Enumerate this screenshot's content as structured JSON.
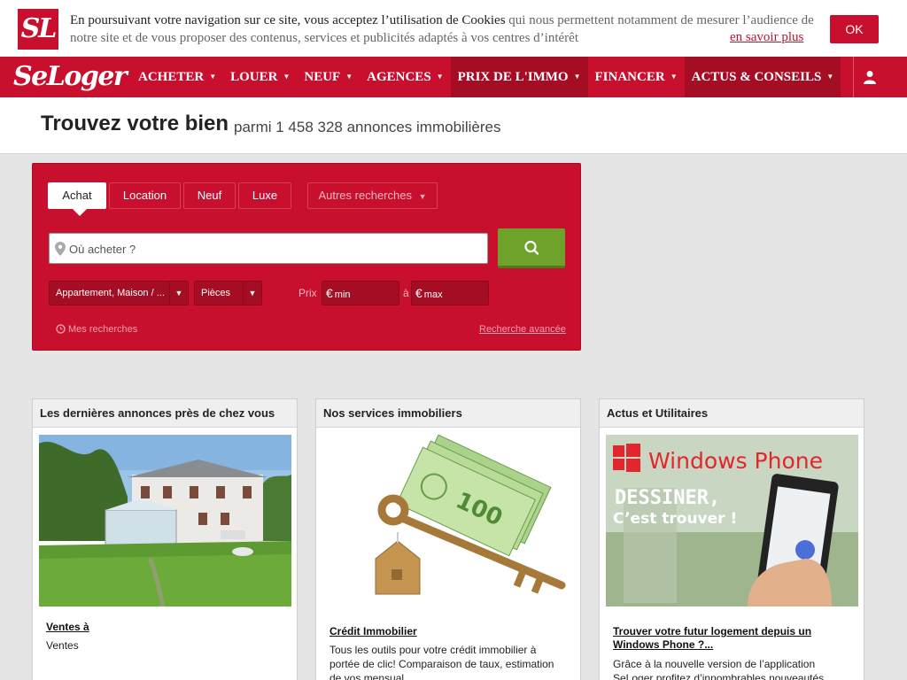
{
  "cookie": {
    "logo": "SL",
    "text_main": "En poursuivant votre navigation sur ce site, vous acceptez l’utilisation de Cookies",
    "text_rest": " qui nous permettent notamment de mesurer l’audience de notre site et de vous proposer des contenus, services et publicités adaptés à vos centres d’intérêt",
    "more_link": "en savoir plus",
    "ok_label": "OK"
  },
  "nav": {
    "brand": "SeLoger",
    "items": [
      {
        "label": "ACHETER"
      },
      {
        "label": "LOUER"
      },
      {
        "label": "NEUF"
      },
      {
        "label": "AGENCES"
      },
      {
        "label": "PRIX DE L'IMMO"
      },
      {
        "label": "FINANCER"
      },
      {
        "label": "ACTUS & CONSEILS"
      }
    ],
    "user_icon": "user-icon"
  },
  "header": {
    "title": "Trouvez votre bien",
    "subtitle": "parmi 1 458 328 annonces immobilières"
  },
  "search": {
    "tabs": [
      {
        "label": "Achat",
        "active": true
      },
      {
        "label": "Location"
      },
      {
        "label": "Neuf"
      },
      {
        "label": "Luxe"
      }
    ],
    "other_searches": "Autres recherches",
    "location_placeholder": "Où acheter ?",
    "type_select": "Appartement, Maison / ...",
    "rooms_select": "Pièces",
    "price_label": "Prix",
    "price_min": "min",
    "price_to": "à",
    "price_max": "max",
    "currency": "€",
    "my_searches": "Mes recherches",
    "advanced": "Recherche avancée",
    "colors": {
      "primary": "#c8102e",
      "search_button": "#6ea22b"
    }
  },
  "cards": [
    {
      "title": "Les dernières annonces près de chez vous",
      "link": "Ventes à",
      "text": "Ventes"
    },
    {
      "title": "Nos services immobiliers",
      "link": "Crédit Immobilier",
      "text": "Tous les outils pour votre crédit immobilier à portée de clic! Comparaison de taux, estimation de vos mensual..."
    },
    {
      "title": "Actus et Utilitaires",
      "link": "Trouver votre futur logement depuis un Windows Phone ?...",
      "text": "Grâce à la nouvelle version de l’application SeLoger profitez d’innombrables nouveautés",
      "banner_brand": "Windows Phone",
      "banner_line1": "DESSINER,",
      "banner_line2": "C’est trouver !"
    }
  ]
}
